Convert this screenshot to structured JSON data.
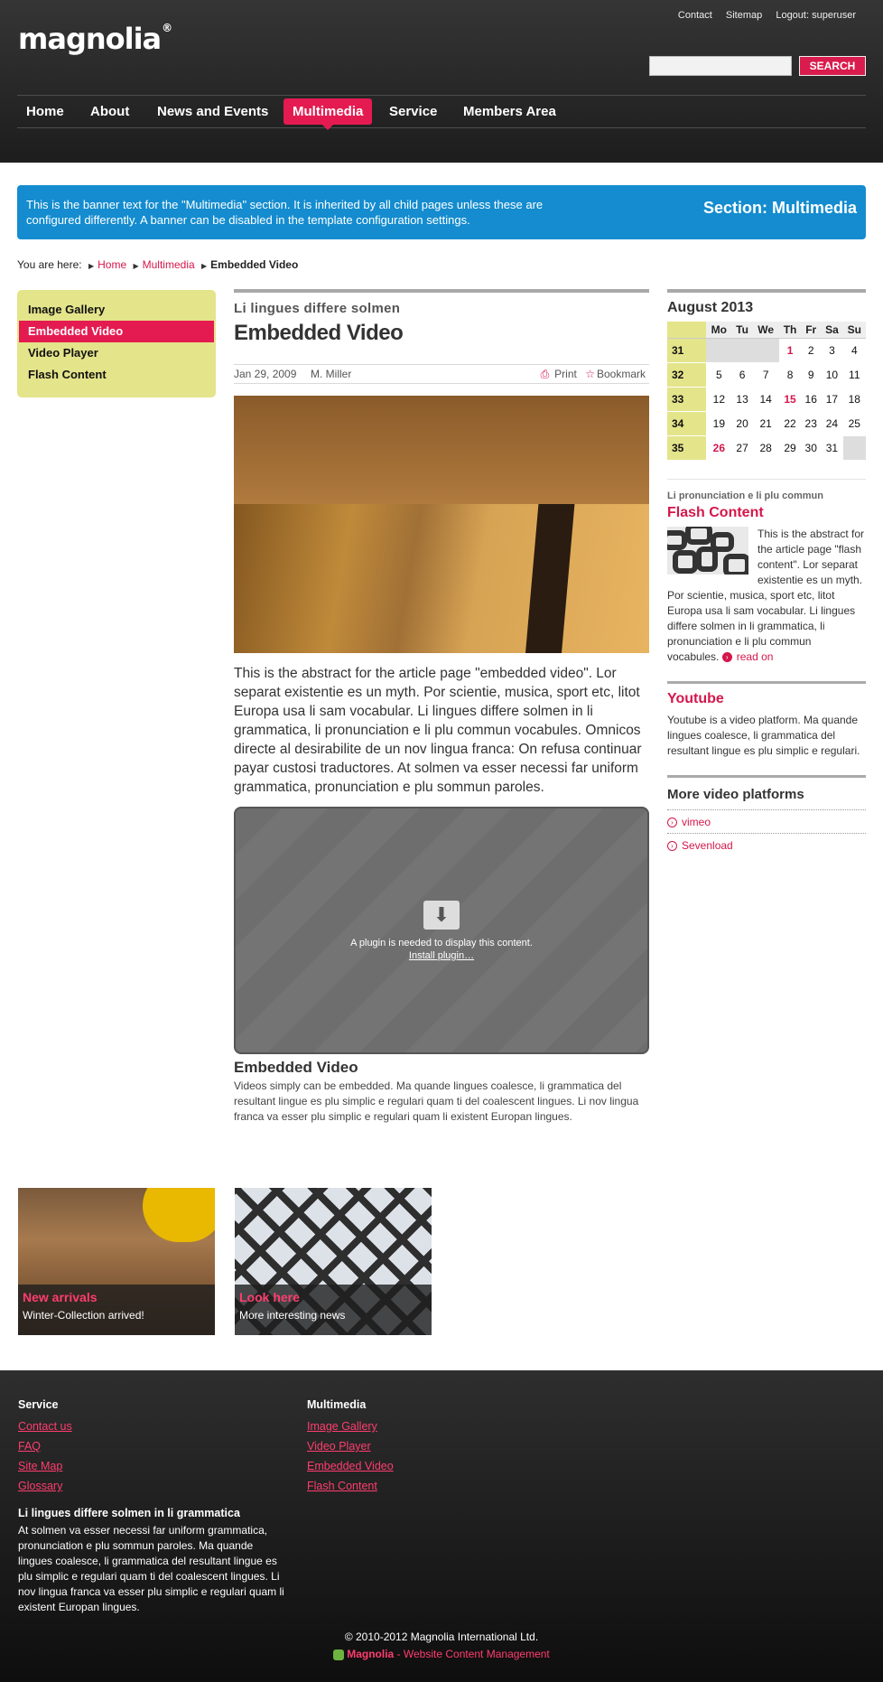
{
  "header": {
    "logo": "magnolia",
    "logo_mark": "®",
    "meta_nav": [
      "Contact",
      "Sitemap",
      "Logout: superuser"
    ],
    "search_placeholder": "",
    "search_button": "SEARCH"
  },
  "nav": {
    "items": [
      "Home",
      "About",
      "News and Events",
      "Multimedia",
      "Service",
      "Members Area"
    ],
    "active": "Multimedia"
  },
  "banner": {
    "text": "This is the banner text for the \"Multimedia\" section. It is inherited by all child pages unless these are configured differently. A banner can be disabled in the template configuration settings.",
    "section": "Section: Multimedia"
  },
  "breadcrumb": {
    "prefix": "You are here:",
    "items": [
      "Home",
      "Multimedia"
    ],
    "current": "Embedded Video"
  },
  "subnav": {
    "items": [
      "Image Gallery",
      "Embedded Video",
      "Video Player",
      "Flash Content"
    ],
    "active": "Embedded Video"
  },
  "article": {
    "kicker": "Li lingues differe solmen",
    "title": "Embedded Video",
    "date": "Jan 29, 2009",
    "author": "M. Miller",
    "print": "Print",
    "bookmark": "Bookmark",
    "abstract": "This is the abstract for the article page \"embedded video\". Lor separat existentie es un myth. Por scientie, musica, sport etc, litot Europa usa li sam vocabular. Li lingues differe solmen in li grammatica, li pronunciation e li plu commun vocabules. Omnicos directe al desirabilite de un nov lingua franca: On refusa continuar payar custosi traductores. At solmen va esser necessi far uniform grammatica, pronunciation e plu sommun paroles.",
    "plugin_message": "A plugin is needed to display this content.",
    "plugin_link": "Install plugin…",
    "video_title": "Embedded Video",
    "video_text": "Videos simply can be embedded. Ma quande lingues coalesce, li grammatica del resultant lingue es plu simplic e regulari quam ti del coalescent lingues. Li nov lingua franca va esser plu simplic e regulari quam li existent Europan lingues."
  },
  "calendar": {
    "title": "August 2013",
    "days": [
      "Mo",
      "Tu",
      "We",
      "Th",
      "Fr",
      "Sa",
      "Su"
    ],
    "weeks": [
      {
        "wk": "31",
        "d": [
          "",
          "",
          "",
          "1",
          "2",
          "3",
          "4"
        ]
      },
      {
        "wk": "32",
        "d": [
          "5",
          "6",
          "7",
          "8",
          "9",
          "10",
          "11"
        ]
      },
      {
        "wk": "33",
        "d": [
          "12",
          "13",
          "14",
          "15",
          "16",
          "17",
          "18"
        ]
      },
      {
        "wk": "34",
        "d": [
          "19",
          "20",
          "21",
          "22",
          "23",
          "24",
          "25"
        ]
      },
      {
        "wk": "35",
        "d": [
          "26",
          "27",
          "28",
          "29",
          "30",
          "31",
          ""
        ]
      }
    ],
    "highlighted": [
      "1",
      "15",
      "26"
    ]
  },
  "sidebar": {
    "flash_kicker": "Li pronunciation e li plu commun",
    "flash_title": "Flash Content",
    "flash_text": "This is the abstract for the article page \"flash content\". Lor separat existentie es un myth. Por scientie, musica, sport etc, litot Europa usa li sam vocabular. Li lingues differe solmen in li grammatica, li pronunciation e li plu commun vocabules.",
    "read_on": "read on",
    "youtube_title": "Youtube",
    "youtube_text": "Youtube is a video platform. Ma quande lingues coalesce, li grammatica del resultant lingue es plu simplic e regulari.",
    "more_title": "More video platforms",
    "more_items": [
      "vimeo",
      "Sevenload"
    ]
  },
  "promos": [
    {
      "title": "New arrivals",
      "sub": "Winter-Collection arrived!"
    },
    {
      "title": "Look here",
      "sub": "More interesting news"
    }
  ],
  "footer": {
    "col1_title": "Service",
    "col1_links": [
      "Contact us",
      "FAQ",
      "Site Map",
      "Glossary"
    ],
    "col2_title": "Multimedia",
    "col2_links": [
      "Image Gallery",
      "Video Player",
      "Embedded Video",
      "Flash Content"
    ],
    "text_title": "Li lingues differe solmen in li grammatica",
    "text": "At solmen va esser necessi far uniform grammatica, pronunciation e plu sommun paroles. Ma quande lingues coalesce, li grammatica del resultant lingue es plu simplic e regulari quam ti del coalescent lingues. Li nov lingua franca va esser plu simplic e regulari quam li existent Europan lingues.",
    "copyright": "© 2010-2012 Magnolia International Ltd.",
    "powered_brand": "Magnolia",
    "powered_rest": " - Website Content Management"
  },
  "colors": {
    "accent": "#e41b51",
    "banner": "#148ccf",
    "subnav_bg": "#e4e48b"
  }
}
